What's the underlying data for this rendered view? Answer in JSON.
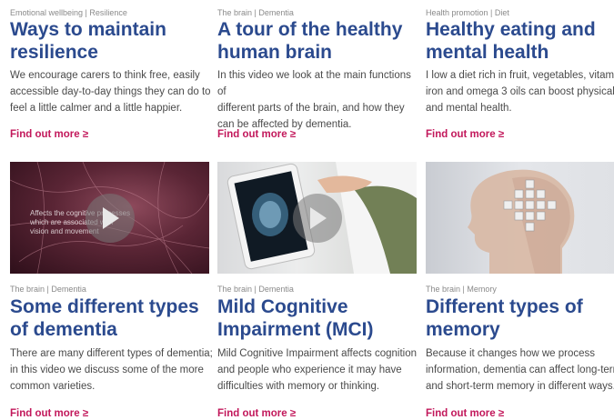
{
  "cards": [
    {
      "category": "Emotional wellbeing | Resilience",
      "title_line1": "Ways to maintain",
      "title_line2": "resilience",
      "desc_lines": [
        "We encourage carers to think free, easily",
        "accessible day-to-day things they can do to",
        "feel a little calmer and a little happier."
      ],
      "link": "Find out more ≥"
    },
    {
      "category": "The brain | Dementia",
      "title_line1": "A tour of the healthy",
      "title_line2": "human brain",
      "desc_lines": [
        "In this video we look at the main functions of",
        "different parts of the brain, and how they",
        "can be affected by dementia."
      ],
      "link": "Find out more ≥"
    },
    {
      "category": "Health promotion | Diet",
      "title_line1": "Healthy eating and",
      "title_line2": "mental health",
      "desc_lines": [
        "I low a diet rich in fruit, vegetables, vitamin",
        "iron and omega 3 oils can boost physical",
        "and mental health."
      ],
      "link": "Find out more ≥"
    },
    {
      "category": "The brain | Dementia",
      "title_line1": "Some different types",
      "title_line2": "of dementia",
      "desc_lines": [
        "There are many different types of dementia;",
        "in this video we discuss some of the more",
        "common varieties."
      ],
      "link": "Find out more ≥",
      "thumb_text": [
        "Affects the cognitive processes",
        "which are associated with",
        "vision and movement"
      ]
    },
    {
      "category": "The brain | Dementia",
      "title_line1": "Mild Cognitive",
      "title_line2": "Impairment (MCI)",
      "desc_lines": [
        "Mild Cognitive Impairment affects cognition",
        "and people who experience it may have",
        "difficulties with memory or thinking."
      ],
      "link": "Find out more ≥"
    },
    {
      "category": "The brain | Memory",
      "title_line1": "Different types of",
      "title_line2": "memory",
      "desc_lines": [
        "Because it changes how we process",
        "information, dementia can affect long-term",
        "and short-term memory in different ways."
      ],
      "link": "Find out more ≥"
    }
  ],
  "colors": {
    "title": "#2b4a8e",
    "link": "#c2185b",
    "category": "#8a8a8a",
    "text": "#4a4a4a"
  },
  "icons": {
    "play": "play-icon",
    "chevron": "chevron-right-icon"
  }
}
